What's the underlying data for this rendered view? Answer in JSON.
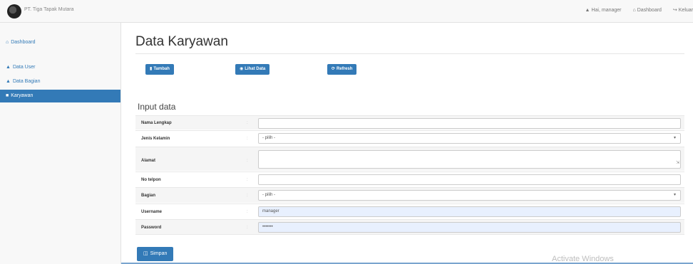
{
  "navbar": {
    "brand": "PT. Tiga Tapak Mutara",
    "user": "Hai, manager",
    "dashboard": "Dashboard",
    "logout": "Keluar"
  },
  "sidebar": {
    "items": [
      {
        "label": "Dashboard",
        "icon": "home-icon"
      },
      {
        "label": "Data User",
        "icon": "user-icon"
      },
      {
        "label": "Data Bagian",
        "icon": "user-icon"
      },
      {
        "label": "Karyawan",
        "icon": "users-icon"
      }
    ]
  },
  "main": {
    "title": "Data Karyawan",
    "buttons": {
      "tambah": "Tambah",
      "lihat": "Lihat Data",
      "refresh": "Refresh"
    },
    "subtitle": "Input data",
    "form": {
      "nama": {
        "label": "Nama Lengkap",
        "value": ""
      },
      "jenis": {
        "label": "Jenis Kelamin",
        "value": "- pilih -"
      },
      "alamat": {
        "label": "Alamat",
        "value": ""
      },
      "telp": {
        "label": "No telpon",
        "value": ""
      },
      "bagian": {
        "label": "Bagian",
        "value": "- pilih -"
      },
      "username": {
        "label": "Username",
        "value": "manager"
      },
      "password": {
        "label": "Password",
        "value": "•••••••"
      }
    },
    "colon": ":",
    "save": "Simpan"
  },
  "overlay": {
    "watermark": "Activate Windows"
  },
  "colors": {
    "primary": "#337ab7",
    "autofill": "#e8f0fe"
  }
}
